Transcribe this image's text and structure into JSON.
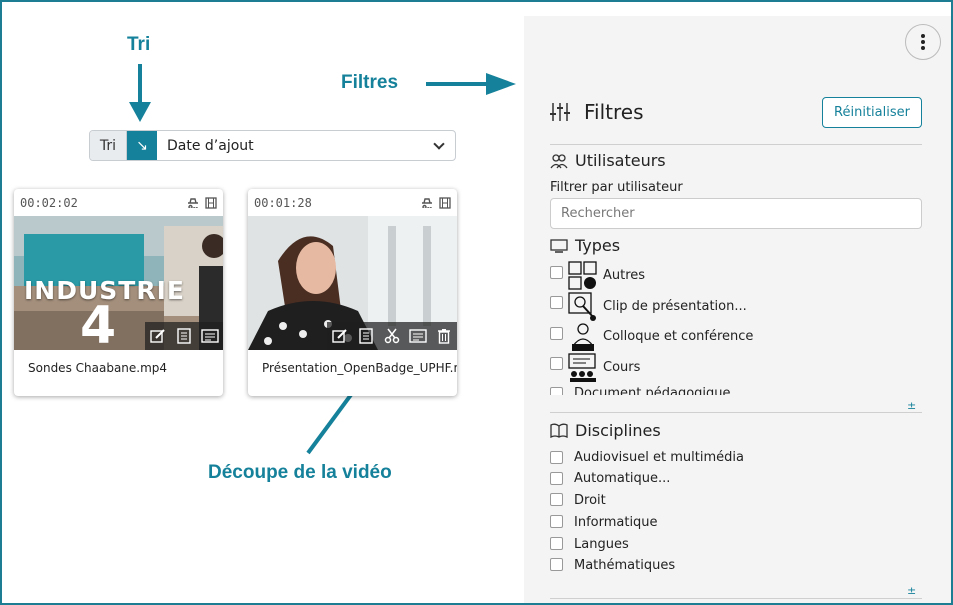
{
  "annotations": {
    "tri": "Tri",
    "filtres": "Filtres",
    "decoupe": "Découpe de la vidéo"
  },
  "colors": {
    "accent": "#15819a",
    "panel_bg": "#f4f4f4"
  },
  "sort": {
    "label": "Tri",
    "direction_icon": "↘",
    "selected": "Date d’ajout"
  },
  "cards": [
    {
      "duration": "00:02:02",
      "title": "Sondes Chaabane.mp4",
      "overlay_title": "INDUSTRIE",
      "overlay_number": "4",
      "actions": [
        "edit-icon",
        "document-icon",
        "subtitles-icon"
      ]
    },
    {
      "duration": "00:01:28",
      "title": "Présentation_OpenBadge_UPHF.m",
      "actions": [
        "edit-icon",
        "document-icon",
        "scissors-icon",
        "subtitles-icon",
        "trash-icon"
      ]
    }
  ],
  "filters": {
    "title": "Filtres",
    "reset": "Réinitialiser",
    "users": {
      "title": "Utilisateurs",
      "filter_label": "Filtrer par utilisateur",
      "placeholder": "Rechercher"
    },
    "types": {
      "title": "Types",
      "items": [
        "Autres",
        "Clip de présentation...",
        "Colloque et conférence",
        "Cours",
        "Document pédagogique"
      ],
      "more": "±"
    },
    "disciplines": {
      "title": "Disciplines",
      "items": [
        "Audiovisuel et multimédia",
        "Automatique...",
        "Droit",
        "Informatique",
        "Langues",
        "Mathématiques"
      ],
      "more": "±"
    }
  }
}
